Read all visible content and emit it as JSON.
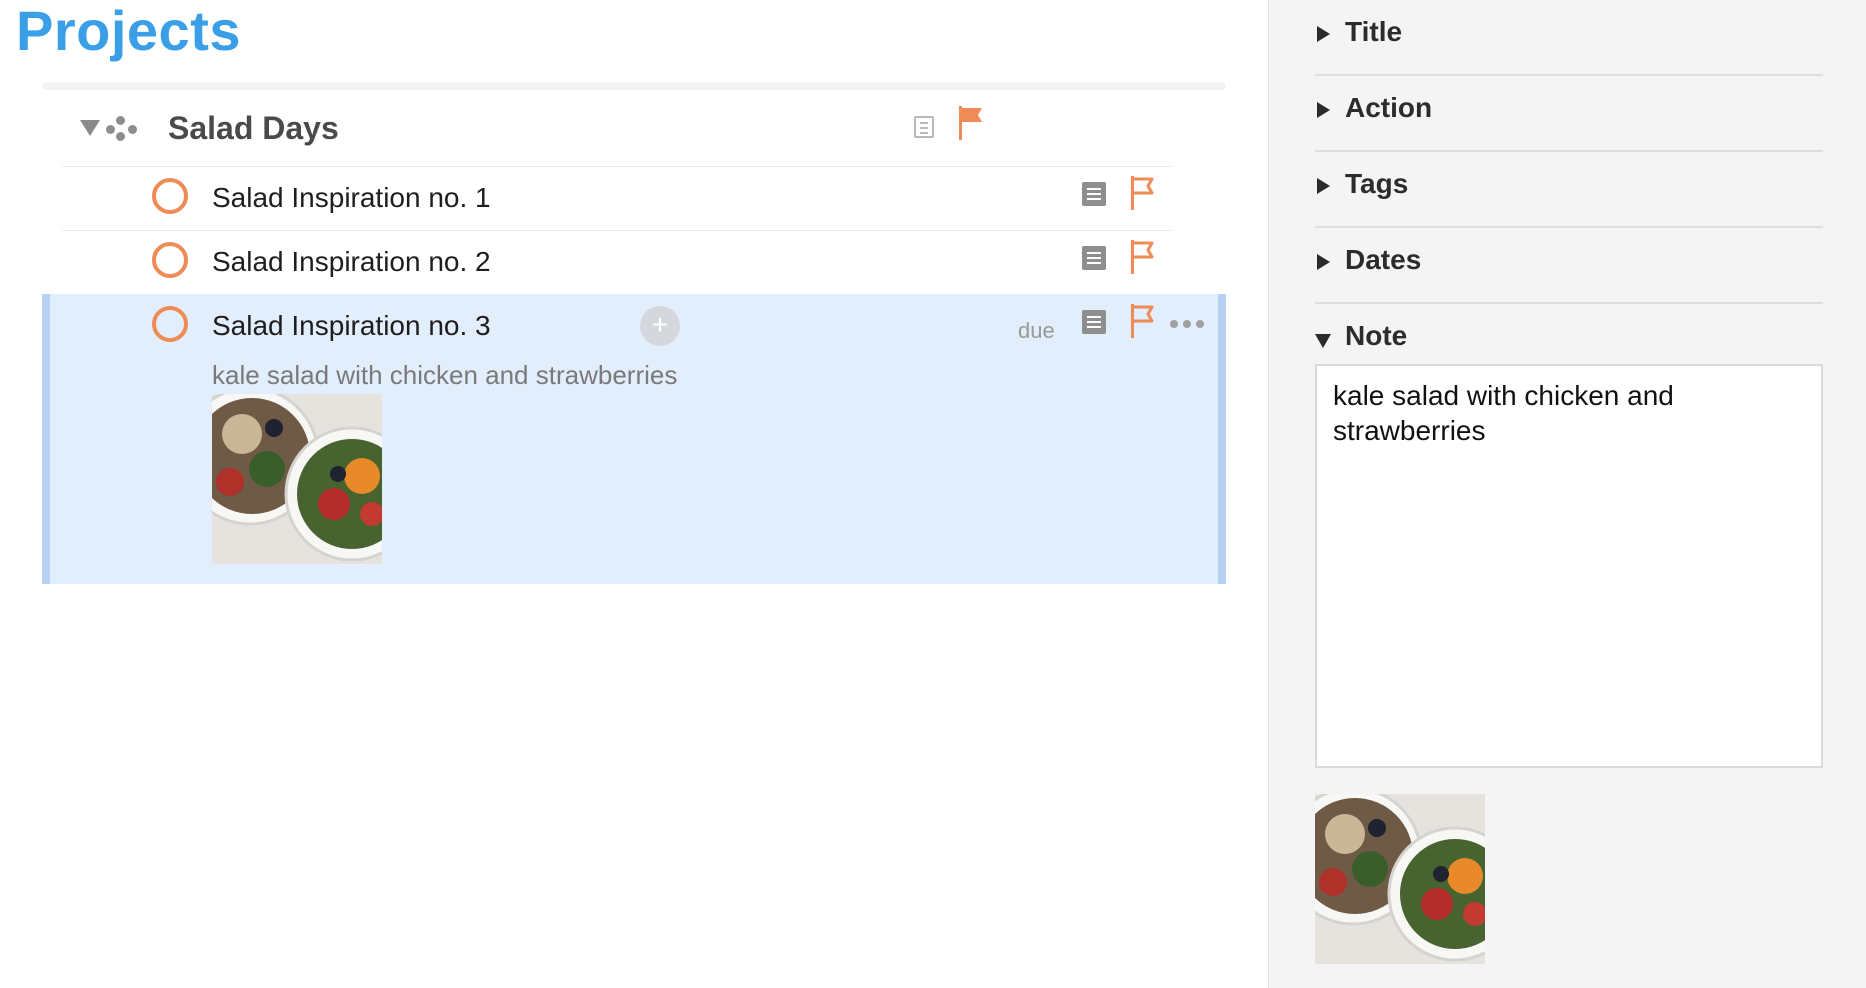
{
  "header": {
    "title": "Projects"
  },
  "project": {
    "title": "Salad Days",
    "flagged": true,
    "tasks": [
      {
        "title": "Salad Inspiration no. 1",
        "flagged": true
      },
      {
        "title": "Salad Inspiration no. 2",
        "flagged": true
      },
      {
        "title": "Salad Inspiration no. 3",
        "due_label": "due",
        "add_symbol": "+",
        "note": "kale salad with chicken and strawberries",
        "selected": true
      }
    ]
  },
  "inspector": {
    "sections": [
      {
        "label": "Title",
        "expanded": false
      },
      {
        "label": "Action",
        "expanded": false
      },
      {
        "label": "Tags",
        "expanded": false
      },
      {
        "label": "Dates",
        "expanded": false
      },
      {
        "label": "Note",
        "expanded": true
      }
    ],
    "note_text": "kale salad with chicken and strawberries"
  },
  "colors": {
    "accent_title": "#3b9fe8",
    "flag": "#ee8b56",
    "checkbox": "#ee8b56",
    "selection": "#e3eefc"
  },
  "icons": {
    "disclosure": "triangle-down-icon",
    "project": "project-dots-icon",
    "note": "note-icon",
    "flag": "flag-icon",
    "more": "ellipsis-icon",
    "image": "salad-photo"
  }
}
